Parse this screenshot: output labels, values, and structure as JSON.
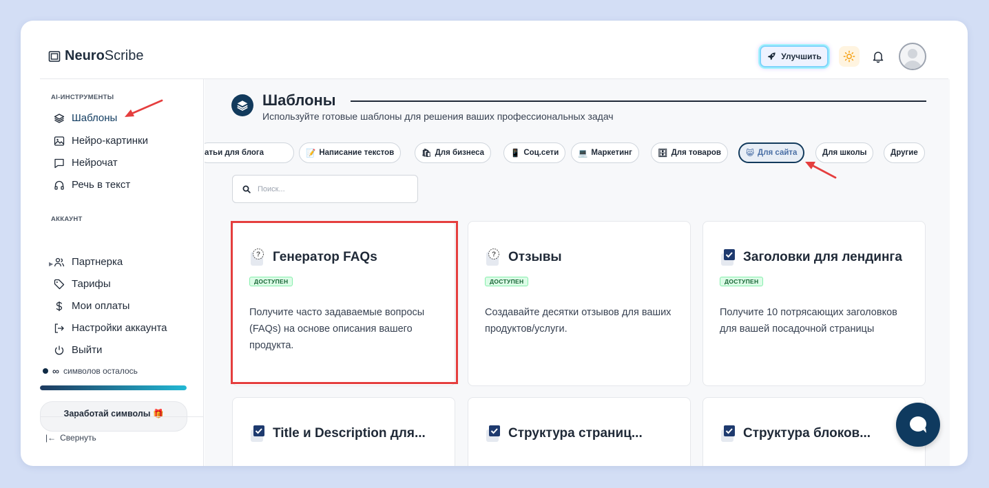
{
  "app": {
    "name_bold": "Neuro",
    "name_rest": "Scribe"
  },
  "header": {
    "upgrade_label": "Улучшить"
  },
  "sidebar": {
    "tools_title": "AI-ИНСТРУМЕНТЫ",
    "tools": [
      {
        "label": "Шаблоны",
        "icon": "layers-icon",
        "active": true
      },
      {
        "label": "Нейро-картинки",
        "icon": "image-icon"
      },
      {
        "label": "Нейрочат",
        "icon": "chat-icon"
      },
      {
        "label": "Речь в текст",
        "icon": "headphones-icon"
      }
    ],
    "account_title": "АККАУНТ",
    "account": [
      {
        "label": "Партнерка",
        "icon": "users-icon"
      },
      {
        "label": "Тарифы",
        "icon": "tag-icon"
      },
      {
        "label": "Мои оплаты",
        "icon": "dollar-icon"
      },
      {
        "label": "Настройки аккаунта",
        "icon": "logout-arrow-icon"
      },
      {
        "label": "Выйти",
        "icon": "power-icon"
      }
    ],
    "symbols_count": "∞",
    "symbols_label": "символов осталось",
    "symbols_fill_fraction": 1.0,
    "earn_label": "Заработай символы 🎁",
    "collapse_label": "Свернуть"
  },
  "main": {
    "title": "Шаблоны",
    "subtitle": "Используйте готовые шаблоны для решения ваших профессиональных задач",
    "categories": [
      {
        "label": "атьи для блога",
        "icon": ""
      },
      {
        "label": "Написание текстов",
        "icon": "📝"
      },
      {
        "label": "Для бизнеса",
        "icon": "🛍"
      },
      {
        "label": "Соц.сети",
        "icon": "📱"
      },
      {
        "label": "Маркетинг",
        "icon": "💻"
      },
      {
        "label": "Для товаров",
        "icon": "🗄"
      },
      {
        "label": "Для сайта",
        "icon": "😸",
        "active": true
      },
      {
        "label": "Для школы",
        "icon": ""
      },
      {
        "label": "Другие",
        "icon": ""
      }
    ],
    "search_placeholder": "Поиск...",
    "cards": [
      {
        "title": "Генератор FAQs",
        "icon": "question-icon",
        "badge": "ДОСТУПЕН",
        "desc": "Получите часто задаваемые вопросы (FAQs) на основе описания вашего продукта."
      },
      {
        "title": "Отзывы",
        "icon": "question-icon",
        "badge": "ДОСТУПЕН",
        "desc": "Создавайте десятки отзывов для ваших продуктов/услуги."
      },
      {
        "title": "Заголовки для лендинга",
        "icon": "checkbox-icon",
        "badge": "ДОСТУПЕН",
        "desc": "Получите 10 потрясающих заголовков для вашей посадочной страницы"
      },
      {
        "title": "Title и Description для...",
        "icon": "checkbox-icon",
        "badge": "",
        "desc": ""
      },
      {
        "title": "Структура страниц...",
        "icon": "checkbox-icon",
        "badge": "",
        "desc": ""
      },
      {
        "title": "Структура блоков...",
        "icon": "checkbox-icon",
        "badge": "",
        "desc": ""
      }
    ]
  },
  "colors": {
    "primary": "#123a5c",
    "highlight": "#e53e3e",
    "badge_bg": "#dcfce7",
    "badge_text": "#166534"
  }
}
